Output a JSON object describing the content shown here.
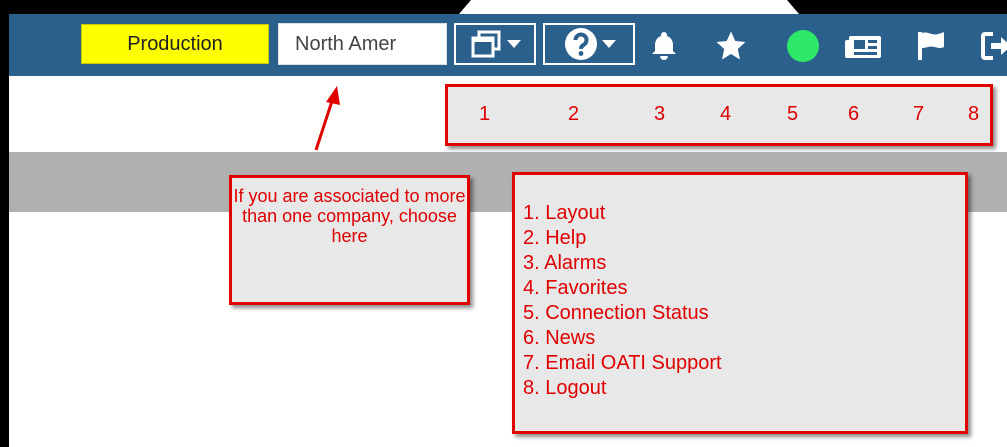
{
  "header": {
    "environment_label": "Production",
    "company_select_value": "North Amer",
    "icons": [
      "layout-icon",
      "help-icon",
      "bell-icon",
      "star-icon",
      "status-dot",
      "news-icon",
      "flag-icon",
      "logout-icon"
    ],
    "header_color": "#2b5f8c",
    "environment_color": "#ffff00",
    "status_color": "#2ee86a"
  },
  "annotation": {
    "numbers": [
      "1",
      "2",
      "3",
      "4",
      "5",
      "6",
      "7",
      "8"
    ],
    "company_note": "If you are associated to more than one company, choose here",
    "legend_items": [
      "1. Layout",
      "2. Help",
      "3. Alarms",
      "4. Favorites",
      "5. Connection Status",
      "6. News",
      "7. Email OATI Support",
      "8. Logout"
    ],
    "annotation_color": "#e00000"
  }
}
